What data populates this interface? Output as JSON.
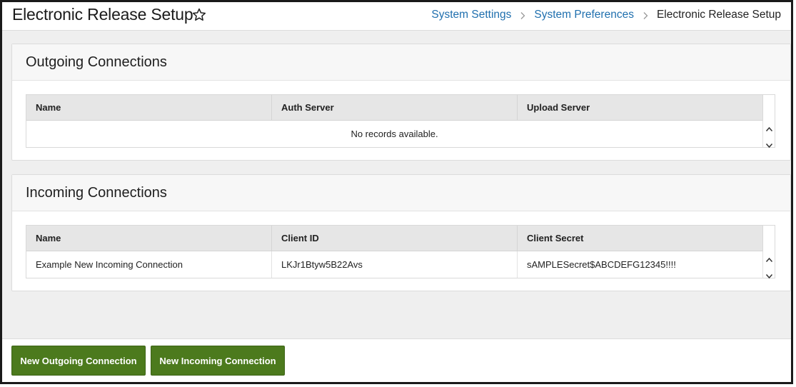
{
  "header": {
    "title": "Electronic Release Setup",
    "favorite_icon": "star-outline-icon",
    "breadcrumb": [
      {
        "label": "System Settings"
      },
      {
        "label": "System Preferences"
      },
      {
        "label": "Electronic Release Setup"
      }
    ]
  },
  "outgoing": {
    "title": "Outgoing Connections",
    "columns": [
      "Name",
      "Auth Server",
      "Upload Server"
    ],
    "empty_message": "No records available."
  },
  "incoming": {
    "title": "Incoming Connections",
    "columns": [
      "Name",
      "Client ID",
      "Client Secret"
    ],
    "rows": [
      [
        "Example New Incoming Connection",
        "LKJr1Btyw5B22Avs",
        "sAMPLESecret$ABCDEFG12345!!!!"
      ]
    ]
  },
  "footer": {
    "new_outgoing_label": "New Outgoing Connection",
    "new_incoming_label": "New Incoming Connection"
  },
  "colors": {
    "link": "#1f6fae",
    "button_green": "#4c7a1d",
    "grid_header": "#e6e6e6"
  }
}
